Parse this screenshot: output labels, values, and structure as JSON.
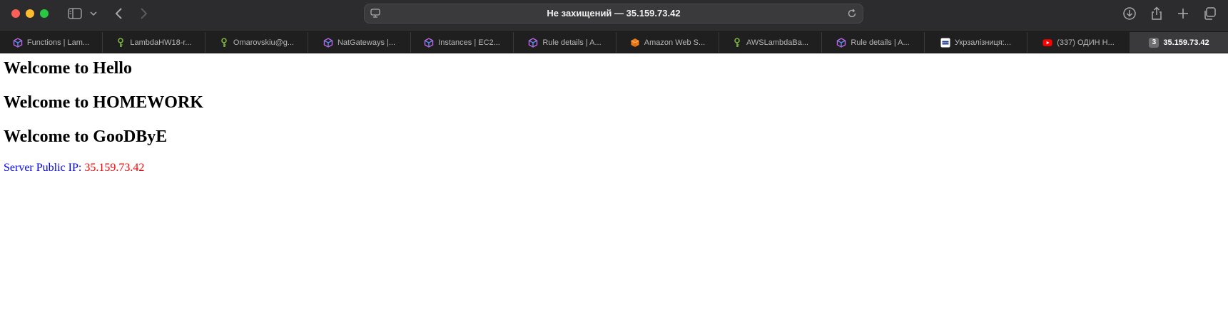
{
  "browser": {
    "address": "Не захищений — 35.159.73.42"
  },
  "tabs": [
    {
      "title": "Functions | Lam...",
      "icon": "aws-cube-icon"
    },
    {
      "title": "LambdaHW18-r...",
      "icon": "key-icon"
    },
    {
      "title": "Omarovskiu@g...",
      "icon": "key-icon"
    },
    {
      "title": "NatGateways |...",
      "icon": "aws-cube-icon"
    },
    {
      "title": "Instances | EC2...",
      "icon": "aws-cube-icon"
    },
    {
      "title": "Rule details | A...",
      "icon": "aws-cube-icon"
    },
    {
      "title": "Amazon Web S...",
      "icon": "aws-orange-cube-icon"
    },
    {
      "title": "AWSLambdaBa...",
      "icon": "key-icon"
    },
    {
      "title": "Rule details | A...",
      "icon": "aws-cube-icon"
    },
    {
      "title": "Укрзалізниця:...",
      "icon": "uz-logo-icon"
    },
    {
      "title": "(337) ОДИН Н...",
      "icon": "youtube-icon"
    }
  ],
  "active_tab": {
    "badge": "3",
    "title": "35.159.73.42"
  },
  "page": {
    "headings": [
      "Welcome to Hello",
      "Welcome to HOMEWORK",
      "Welcome to GooDByE"
    ],
    "ip_label": "Server Public IP: ",
    "ip_value": "35.159.73.42"
  },
  "colors": {
    "ip_label": "#0000ff",
    "ip_value": "#ff0000",
    "toolbar_bg": "#2c2c2e",
    "tabbar_bg": "#1f1f1f"
  }
}
